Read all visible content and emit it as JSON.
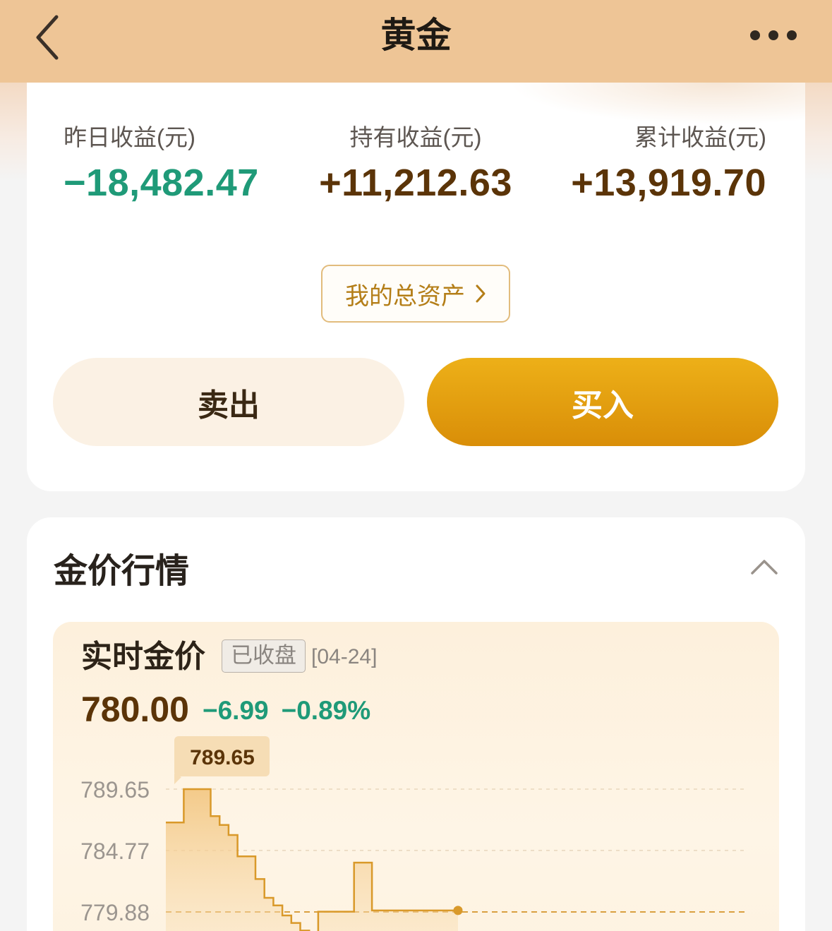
{
  "header": {
    "title": "黄金"
  },
  "summary": {
    "stats": [
      {
        "label": "昨日收益(元)",
        "value": "−18,482.47"
      },
      {
        "label": "持有收益(元)",
        "value": "+11,212.63"
      },
      {
        "label": "累计收益(元)",
        "value": "+13,919.70"
      }
    ],
    "assets_button": "我的总资产",
    "sell_button": "卖出",
    "buy_button": "买入"
  },
  "market": {
    "section_title": "金价行情",
    "realtime_title": "实时金价",
    "status_badge": "已收盘",
    "date": "[04-24]",
    "price": "780.00",
    "change": "−6.99",
    "change_pct": "−0.89%",
    "tooltip": "789.65"
  },
  "colors": {
    "header": "#eec596",
    "accent": "#e09a0c",
    "down": "#1f9a78",
    "price": "#5b3408"
  },
  "chart_data": {
    "type": "line",
    "title": "",
    "xlabel": "",
    "ylabel": "",
    "yticks": [
      "789.65",
      "784.77",
      "779.88"
    ],
    "ylim": [
      777.5,
      792.5
    ],
    "reference_line": 779.88,
    "x": [
      0,
      1,
      2,
      3,
      4,
      5,
      6,
      7,
      8,
      9,
      10,
      11,
      12,
      13,
      14,
      15,
      16,
      17,
      18,
      19,
      20,
      21,
      22,
      23,
      24,
      25,
      26,
      27,
      28
    ],
    "values": [
      787.0,
      787.0,
      789.65,
      789.65,
      789.65,
      787.5,
      786.8,
      786.0,
      784.3,
      784.3,
      782.5,
      781.0,
      780.4,
      779.6,
      779.0,
      778.4,
      777.8,
      779.9,
      779.9,
      779.9,
      779.9,
      783.8,
      783.8,
      780.0,
      780.0,
      780.0,
      780.0,
      780.0,
      780.0
    ],
    "last_value": 780.0
  }
}
